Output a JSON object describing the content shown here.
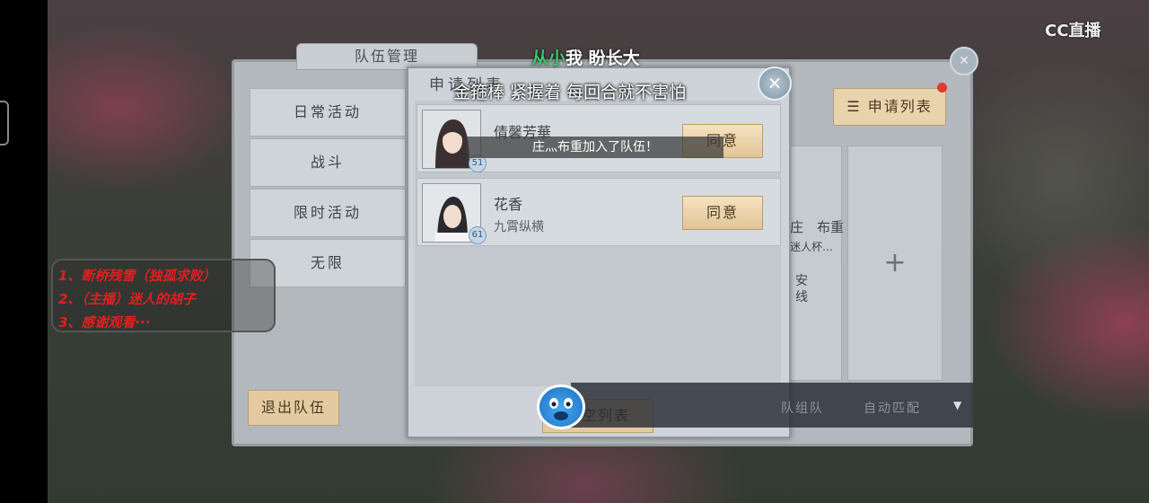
{
  "overlay": {
    "lyric_line1_highlight": "从小",
    "lyric_line1_rest": "我 盼长大",
    "lyric_line2": "金箍棒 紧握着 每回合就不害怕",
    "logo": "CC直播"
  },
  "team_panel": {
    "title": "队伍管理",
    "menu": [
      "日常活动",
      "战斗",
      "限时活动",
      "无限"
    ],
    "apply_list_label": "申请列表",
    "member_name": "庄　布重",
    "member_line2": "迷人杯…",
    "member_line3": "安",
    "member_line4": "线",
    "add_slot": "+",
    "exit_label": "退出队伍",
    "bottom_left": "队组队",
    "bottom_right": "自动匹配"
  },
  "dialog": {
    "title": "申请列表",
    "close": "×",
    "requests": [
      {
        "name": "倩馨芳華",
        "sub": "",
        "level": "51",
        "agree": "同意"
      },
      {
        "name": "花香",
        "sub": "九霄纵横",
        "level": "61",
        "agree": "同意"
      }
    ],
    "bottom_button": "清空列表"
  },
  "toast": "庄灬布重加入了队伍！",
  "streamer_notes": [
    "1、断桥残雪（独孤求败）",
    "2、（主播）迷人的胡子",
    "3、感谢观看···"
  ],
  "chat": {
    "caret": "▼"
  }
}
